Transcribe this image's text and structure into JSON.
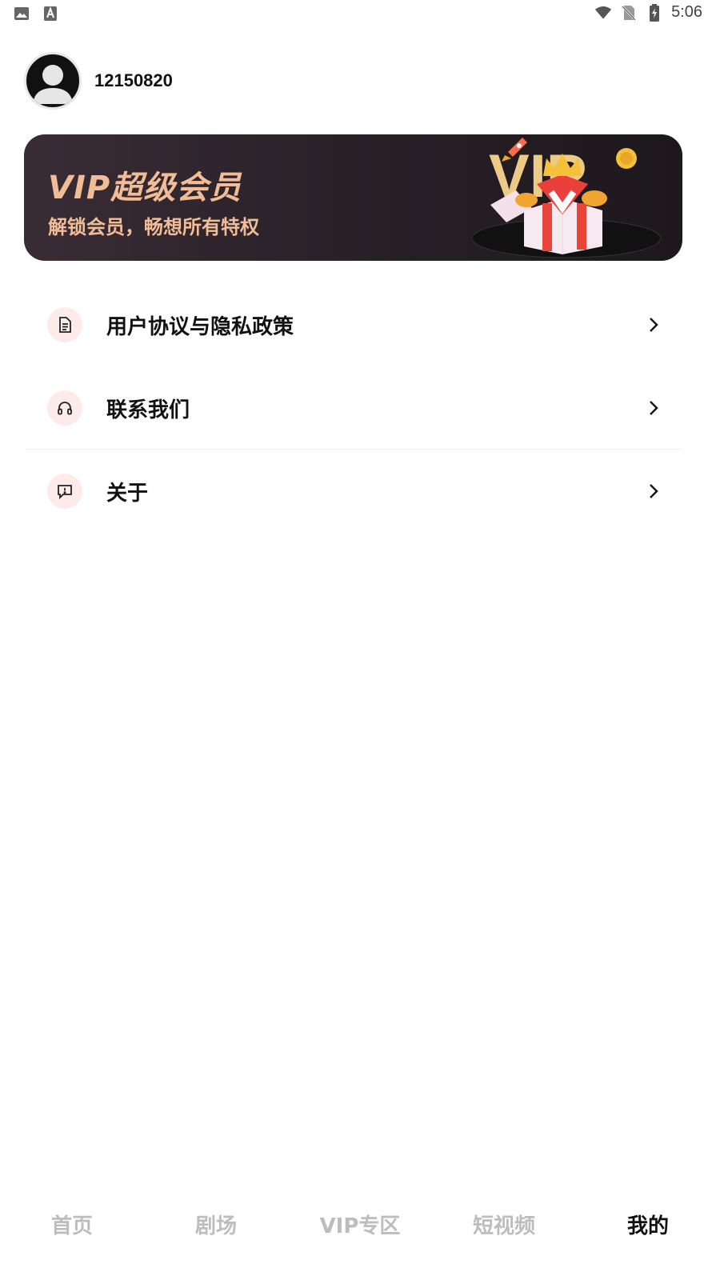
{
  "status_bar": {
    "time": "5:06",
    "left_icons": [
      "image-icon",
      "text-a-icon"
    ],
    "right_icons": [
      "wifi-icon",
      "no-sim-icon",
      "battery-charging-icon"
    ]
  },
  "profile": {
    "avatar_icon": "user-avatar-icon",
    "user_id": "12150820"
  },
  "vip_banner": {
    "title": "VIP超级会员",
    "subtitle": "解锁会员，畅想所有特权",
    "title_color": "#f1bd96",
    "art_icon": "vip-gift-box-icon"
  },
  "menu": {
    "items": [
      {
        "label": "用户协议与隐私政策",
        "icon": "document-icon"
      },
      {
        "label": "联系我们",
        "icon": "headset-icon"
      },
      {
        "label": "关于",
        "icon": "message-alert-icon"
      }
    ],
    "icon_bg": "#fdebea"
  },
  "bottom_nav": {
    "items": [
      {
        "label": "首页",
        "active": false
      },
      {
        "label": "剧场",
        "active": false
      },
      {
        "label": "VIP专区",
        "active": false
      },
      {
        "label": "短视频",
        "active": false
      },
      {
        "label": "我的",
        "active": true
      }
    ],
    "active_color": "#111111",
    "inactive_color": "#bdbdbd"
  }
}
